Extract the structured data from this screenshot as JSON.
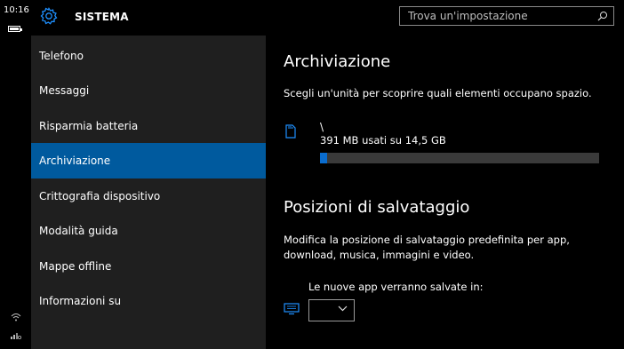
{
  "status": {
    "time": "10:16"
  },
  "header": {
    "title": "SISTEMA",
    "search_placeholder": "Trova un'impostazione"
  },
  "sidebar": {
    "items": [
      {
        "label": "Telefono"
      },
      {
        "label": "Messaggi"
      },
      {
        "label": "Risparmia batteria"
      },
      {
        "label": "Archiviazione",
        "selected": true
      },
      {
        "label": "Crittografia dispositivo"
      },
      {
        "label": "Modalità guida"
      },
      {
        "label": "Mappe offline"
      },
      {
        "label": "Informazioni su"
      }
    ]
  },
  "content": {
    "title": "Archiviazione",
    "description": "Scegli un'unità per scoprire quali elementi occupano spazio.",
    "drive": {
      "name": "\\",
      "usage_text": "391 MB usati su 14,5 GB",
      "used_fraction": 0.027
    },
    "save_section": {
      "title": "Posizioni di salvataggio",
      "description_line1": "Modifica la posizione di salvataggio predefinita per app,",
      "description_line2": "download, musica, immagini e video.",
      "new_apps_label": "Le nuove app verranno salvate in:",
      "new_apps_value": ""
    }
  },
  "colors": {
    "accent": "#005a9e",
    "progress_fill": "#0a6cce",
    "sidebar_bg": "#1f1f1f",
    "content_bg": "#000000"
  }
}
